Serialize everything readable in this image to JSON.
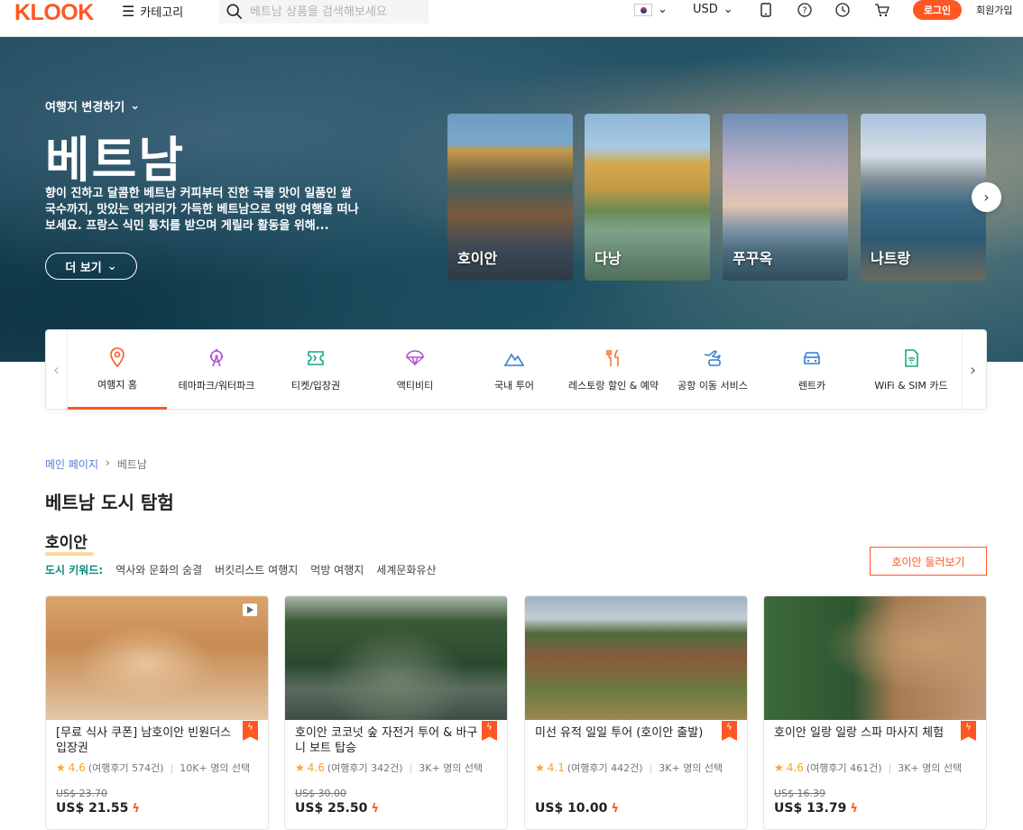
{
  "header": {
    "logo": "KLOOK",
    "category_label": "카테고리",
    "search_placeholder": "베트남 상품을 검색해보세요",
    "currency": "USD",
    "login_label": "로그인",
    "signup_label": "회원가입"
  },
  "hero": {
    "change_destination": "여행지 변경하기",
    "title": "베트남",
    "description": "향이 진하고 달콤한 베트남 커피부터 진한 국물 맛이 일품인 쌀국수까지, 맛있는 먹거리가 가득한 베트남으로 먹방 여행을 떠나보세요. 프랑스 식민 통치를 받으며 게릴라 활동을 위해...",
    "more_label": "더 보기",
    "cities": [
      {
        "name": "호이안"
      },
      {
        "name": "다낭"
      },
      {
        "name": "푸꾸옥"
      },
      {
        "name": "나트랑"
      }
    ]
  },
  "nav": {
    "items": [
      {
        "label": "여행지 홈",
        "icon": "location-pin-icon",
        "active": true
      },
      {
        "label": "테마파크/워터파크",
        "icon": "ferris-wheel-icon"
      },
      {
        "label": "티켓/입장권",
        "icon": "ticket-icon"
      },
      {
        "label": "액티비티",
        "icon": "parachute-icon"
      },
      {
        "label": "국내 투어",
        "icon": "mountain-icon"
      },
      {
        "label": "레스토랑 할인 & 예약",
        "icon": "fork-knife-icon"
      },
      {
        "label": "공항 이동 서비스",
        "icon": "airport-transfer-icon"
      },
      {
        "label": "렌트카",
        "icon": "car-icon"
      },
      {
        "label": "WiFi & SIM 카드",
        "icon": "sim-card-icon"
      }
    ]
  },
  "breadcrumb": {
    "home": "메인 페이지",
    "separator": "›",
    "current": "베트남"
  },
  "section": {
    "title": "베트남 도시 탐험",
    "city": "호이안",
    "keywords_label": "도시 키워드:",
    "keywords": [
      "역사와 문화의 숨결",
      "버킷리스트 여행지",
      "먹방 여행지",
      "세계문화유산"
    ],
    "explore_label": "호이안 둘러보기"
  },
  "cards": [
    {
      "title": "[무료 식사 쿠폰] 남호이안 빈원더스 입장권",
      "score": "4.6",
      "reviews": "(여행후기 574건)",
      "booked": "10K+ 명의 선택",
      "old_price": "US$ 23.70",
      "price": "US$ 21.55",
      "has_video": true
    },
    {
      "title": "호이안 코코넛 숲 자전거 투어 & 바구니 보트 탑승",
      "score": "4.6",
      "reviews": "(여행후기 342건)",
      "booked": "3K+ 명의 선택",
      "old_price": "US$ 30.00",
      "price": "US$ 25.50"
    },
    {
      "title": "미선 유적 일일 투어 (호이안 출발)",
      "score": "4.1",
      "reviews": "(여행후기 442건)",
      "booked": "3K+ 명의 선택",
      "old_price": "",
      "price": "US$ 10.00"
    },
    {
      "title": "호이안 일랑 일랑 스파 마사지 체험",
      "score": "4.6",
      "reviews": "(여행후기 461건)",
      "booked": "3K+ 명의 선택",
      "old_price": "US$ 16.39",
      "price": "US$ 13.79"
    }
  ],
  "colors": {
    "brand": "#ff5722",
    "keyword": "#0b8a7e",
    "star": "#f5a623"
  }
}
